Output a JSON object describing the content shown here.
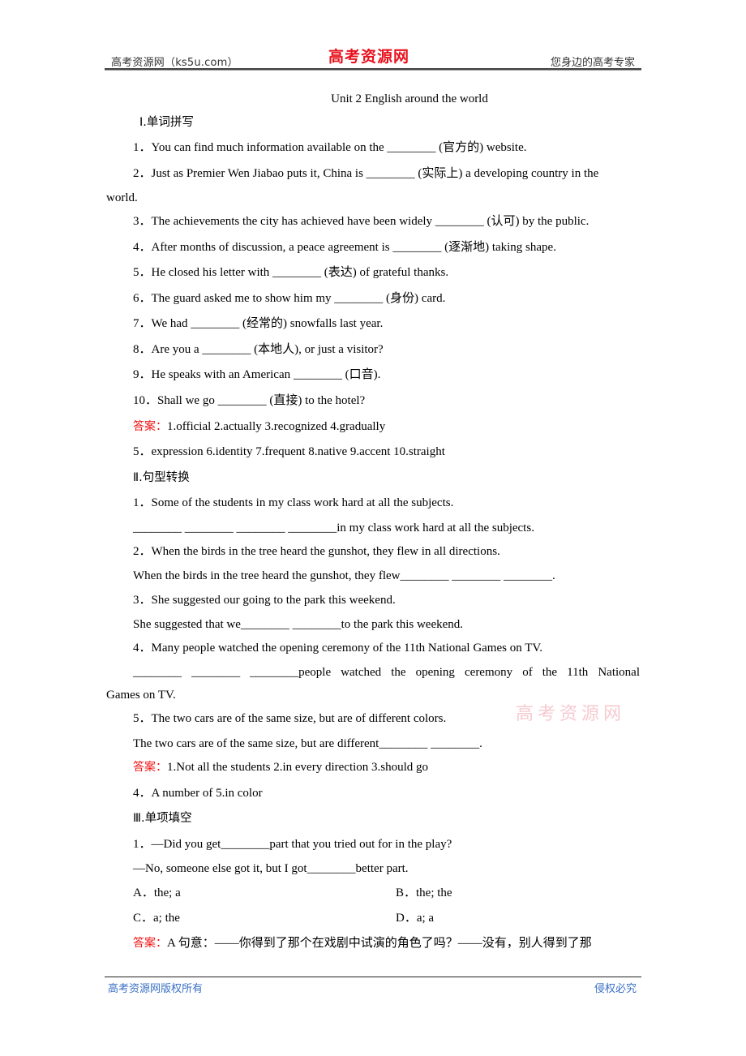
{
  "header": {
    "left": "高考资源网（ks5u.com）",
    "logo": "高考资源网",
    "right": "您身边的高考专家"
  },
  "title": "Unit 2    English around the world",
  "sections": {
    "s1": {
      "heading": "Ⅰ.单词拼写",
      "items": [
        "1．You can find much information available on the ________ (官方的) website.",
        "2．Just as Premier Wen Jiabao puts it, China is ________ (实际上) a developing country in the",
        "world.",
        "3．The achievements the city has achieved have been widely ________ (认可) by the public.",
        "4．After months of discussion, a peace agreement is ________ (逐渐地) taking shape.",
        "5．He closed his letter with ________ (表达) of grateful thanks.",
        "6．The guard asked me to show him my ________ (身份) card.",
        "7．We had ________ (经常的) snowfalls last year.",
        "8．Are you a ________ (本地人), or just a visitor?",
        "9．He speaks with an American ________ (口音).",
        "10．Shall we go ________ (直接) to the hotel?"
      ],
      "answer_label": "答案：",
      "answer_line1": "1.official    2.actually    3.recognized    4.gradually",
      "answer_line2": "5．expression    6.identity    7.frequent    8.native    9.accent    10.straight"
    },
    "s2": {
      "heading": "Ⅱ.句型转换",
      "items": [
        "1．Some of the students in my class work hard at all the subjects.",
        "________ ________ ________ ________in my class work hard at all the subjects.",
        "2．When the birds in the tree heard the gunshot, they flew in all directions.",
        "When the birds in the tree heard the gunshot, they flew________ ________ ________.",
        "3．She suggested our going to the park this weekend.",
        "She suggested that we________ ________to the park this weekend.",
        "4．Many people watched the opening ceremony of the 11th National Games on TV."
      ],
      "item4_blanks": [
        "________",
        "________",
        "________people",
        "watched",
        "the",
        "opening",
        "ceremony",
        "of",
        "the",
        "11th",
        "National"
      ],
      "item4_cont": "Games on TV.",
      "items_b": [
        "5．The two cars are of the same size, but are of different colors.",
        "The two cars are of the same size, but are different________ ________."
      ],
      "answer_label": "答案：",
      "answer_line1": "1.Not all the students    2.in every direction    3.should go",
      "answer_line2": "4．A number of    5.in color"
    },
    "s3": {
      "heading": "Ⅲ.单项填空",
      "q1": "1．—Did you get________part that you tried out for in the play?",
      "q1b": "—No, someone else got it, but I got________better part.",
      "options": [
        "A．the; a",
        "B．the; the",
        "C．a; the",
        "D．a; a"
      ],
      "answer_label": "答案：",
      "answer_text": "A    句意：——你得到了那个在戏剧中试演的角色了吗？——没有，别人得到了那"
    }
  },
  "watermark": "高考资源网",
  "footer": {
    "left": "高考资源网版权所有",
    "right": "侵权必究"
  }
}
